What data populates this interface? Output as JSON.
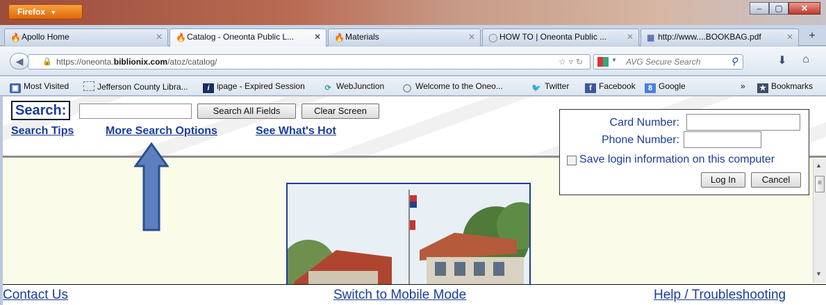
{
  "browser": {
    "menu_button": "Firefox",
    "menu_arrow": "▼",
    "window_controls": {
      "minimize": "–",
      "maximize": "▢",
      "close": "✕"
    },
    "tabs": [
      {
        "label": "Apollo Home",
        "icon": "flame-icon",
        "active": false
      },
      {
        "label": "Catalog - Oneonta Public L...",
        "icon": "flame-icon",
        "active": true
      },
      {
        "label": "Materials",
        "icon": "flame-icon",
        "active": false
      },
      {
        "label": "HOW TO | Oneonta Public ...",
        "icon": "globe-icon",
        "active": false
      },
      {
        "label": "http://www....BOOKBAG.pdf",
        "icon": "pdf-grid-icon",
        "active": false
      }
    ],
    "new_tab_label": "+",
    "address": {
      "prefix": "https://oneonta.",
      "host": "biblionix.com",
      "path": "/atoz/catalog/"
    },
    "search_placeholder": "AVG Secure Search",
    "bookmarks": [
      "Most Visited",
      "Jefferson County Libra...",
      "ipage - Expired Session",
      "WebJunction",
      "Welcome to the Oneo...",
      "Twitter",
      "Facebook",
      "Google"
    ],
    "bookmarks_overflow": "»",
    "bookmarks_menu": "Bookmarks"
  },
  "page": {
    "search_label": "Search:",
    "search_all_button": "Search All Fields",
    "clear_button": "Clear Screen",
    "links": {
      "tips": "Search Tips",
      "more_options": "More Search Options",
      "whats_hot": "See What's Hot"
    },
    "login": {
      "card_label": "Card Number:",
      "phone_label": "Phone Number:",
      "save_label": "Save login information on this computer",
      "login_button": "Log In",
      "cancel_button": "Cancel"
    },
    "footer": {
      "contact": "Contact Us",
      "mobile": "Switch to Mobile Mode",
      "help": "Help / Troubleshooting"
    }
  },
  "colors": {
    "link_blue": "#1a3d99",
    "arrow_fill": "#5b7fbf",
    "arrow_stroke": "#2c4f8c",
    "firefox_orange": "#e0670a"
  }
}
